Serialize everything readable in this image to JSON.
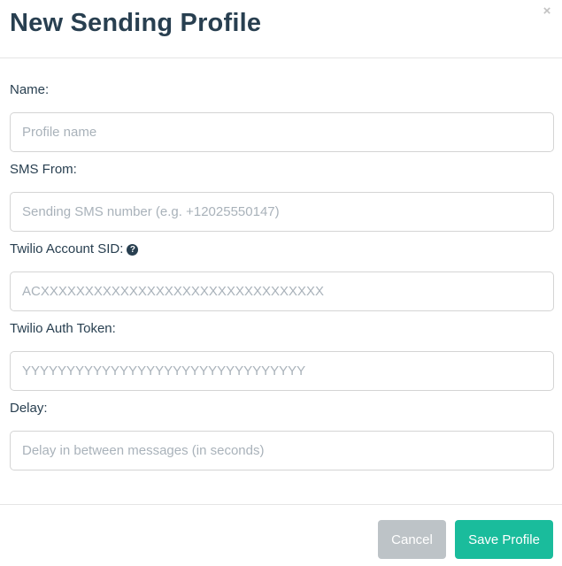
{
  "modal": {
    "title": "New Sending Profile",
    "close_label": "×"
  },
  "form": {
    "name": {
      "label": "Name:",
      "placeholder": "Profile name",
      "value": ""
    },
    "sms_from": {
      "label": "SMS From:",
      "placeholder": "Sending SMS number (e.g. +12025550147)",
      "value": ""
    },
    "account_sid": {
      "label": "Twilio Account SID:",
      "help_icon": "question-circle-icon",
      "help_glyph": "?",
      "placeholder": "ACXXXXXXXXXXXXXXXXXXXXXXXXXXXXXXXX",
      "value": ""
    },
    "auth_token": {
      "label": "Twilio Auth Token:",
      "placeholder": "YYYYYYYYYYYYYYYYYYYYYYYYYYYYYYYY",
      "value": ""
    },
    "delay": {
      "label": "Delay:",
      "placeholder": "Delay in between messages (in seconds)",
      "value": ""
    }
  },
  "footer": {
    "cancel_label": "Cancel",
    "save_label": "Save Profile"
  },
  "colors": {
    "title": "#283f50",
    "cancel_button": "#bdc3c7",
    "save_button": "#1abc9c",
    "placeholder": "#a9b2ba",
    "input_border": "#d4d4d4"
  }
}
